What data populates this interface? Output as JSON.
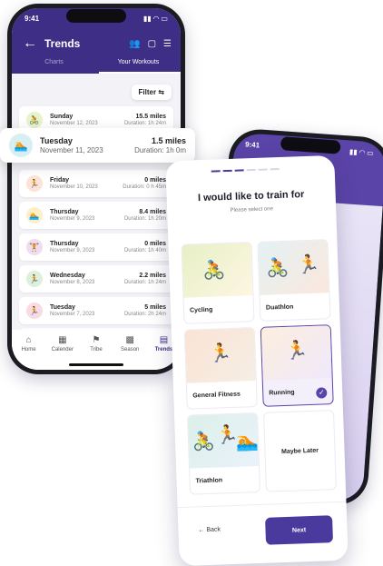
{
  "trends": {
    "status_time": "9:41",
    "title": "Trends",
    "tabs": [
      "Charts",
      "Your Workouts"
    ],
    "filter_label": "Filter",
    "workouts": [
      {
        "day": "Sunday",
        "date": "November 12, 2023",
        "miles": "15.5 miles",
        "duration": "Duration: 1h 24m",
        "icon": "cycling-icon",
        "color": "#e9f3c8",
        "glyph": "🚴"
      },
      {
        "day": "Tuesday",
        "date": "November 11, 2023",
        "miles": "1.5 miles",
        "duration": "Duration: 1h 0m",
        "icon": "swimming-icon",
        "color": "#d7eef3",
        "glyph": "🏊"
      },
      {
        "day": "Friday",
        "date": "November 10, 2023",
        "miles": "0 miles",
        "duration": "Duration: 0 h 45m",
        "icon": "running-icon",
        "color": "#fde3d5",
        "glyph": "🏃"
      },
      {
        "day": "Thursday",
        "date": "November 9, 2023",
        "miles": "8.4 miles",
        "duration": "Duration: 1h 20m",
        "icon": "swimming-icon",
        "color": "#fdf0c9",
        "glyph": "🏊"
      },
      {
        "day": "Thursday",
        "date": "November 9, 2023",
        "miles": "0 miles",
        "duration": "Duration: 1h 40m",
        "icon": "strength-icon",
        "color": "#f1dcef",
        "glyph": "🏋"
      },
      {
        "day": "Wednesday",
        "date": "November 8, 2023",
        "miles": "2.2 miles",
        "duration": "Duration: 1h 24m",
        "icon": "running-icon",
        "color": "#dcf0dc",
        "glyph": "🏃"
      },
      {
        "day": "Tuesday",
        "date": "November 7, 2023",
        "miles": "5 miles",
        "duration": "Duration: 2h 24m",
        "icon": "running-icon",
        "color": "#f8dbe3",
        "glyph": "🏃"
      }
    ],
    "nav": [
      {
        "label": "Home",
        "icon": "home-icon",
        "glyph": "⌂"
      },
      {
        "label": "Calender",
        "icon": "calendar-icon",
        "glyph": "▦"
      },
      {
        "label": "Tribe",
        "icon": "flag-icon",
        "glyph": "⚑"
      },
      {
        "label": "Season",
        "icon": "season-icon",
        "glyph": "▩"
      },
      {
        "label": "Trends",
        "icon": "trends-icon",
        "glyph": "▤"
      }
    ]
  },
  "back_phone": {
    "status_time": "9:41"
  },
  "onboarding": {
    "title": "I would like to train for",
    "subtitle": "Please select one",
    "options": [
      {
        "label": "Cycling",
        "selected": false
      },
      {
        "label": "Duathlon",
        "selected": false
      },
      {
        "label": "General Fitness",
        "selected": false
      },
      {
        "label": "Running",
        "selected": true
      },
      {
        "label": "Triathlon",
        "selected": false
      },
      {
        "label": "Maybe Later",
        "selected": false
      }
    ],
    "back_label": "← Back",
    "next_label": "Next"
  },
  "colors": {
    "brand": "#3e2e86",
    "accent": "#5b44a8"
  }
}
